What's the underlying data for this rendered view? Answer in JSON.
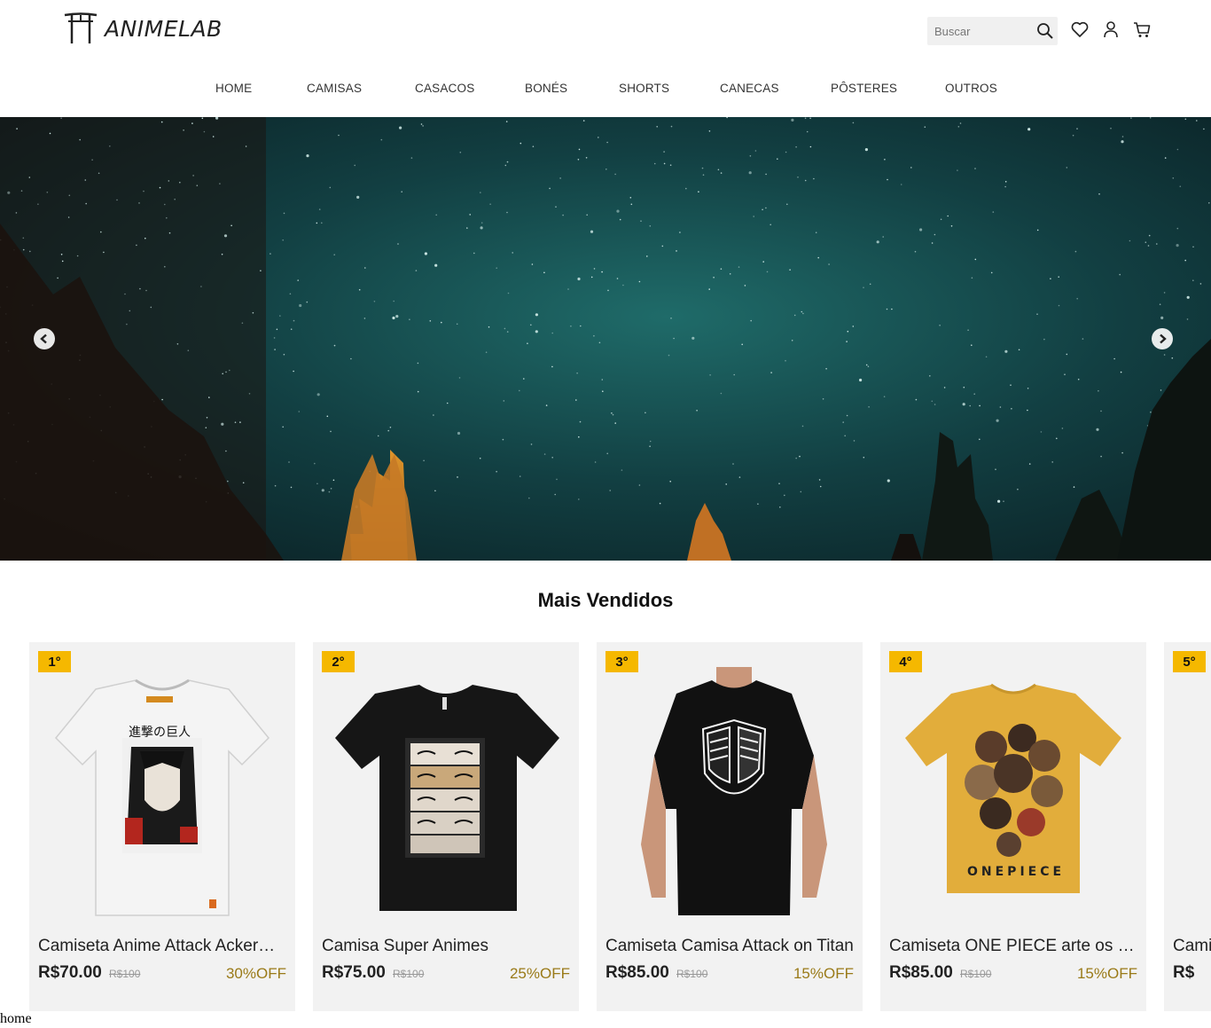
{
  "brand": {
    "name": "ANIMELAB"
  },
  "header": {
    "search_placeholder": "Buscar",
    "icons": [
      "search-icon",
      "heart-icon",
      "user-icon",
      "cart-icon"
    ]
  },
  "nav": {
    "items": [
      {
        "label": "HOME"
      },
      {
        "label": "CAMISAS"
      },
      {
        "label": "CASACOS"
      },
      {
        "label": "BONÉS"
      },
      {
        "label": "SHORTS"
      },
      {
        "label": "CANECAS"
      },
      {
        "label": "PÔSTERES"
      },
      {
        "label": "OUTROS"
      }
    ]
  },
  "hero": {
    "prev_icon": "chevron-left-icon",
    "next_icon": "chevron-right-icon"
  },
  "section": {
    "title": "Mais Vendidos"
  },
  "products": [
    {
      "rank": "1°",
      "name": "Camiseta Anime Attack Ackerman",
      "price": "R$70.00",
      "old_price": "R$100",
      "discount": "30%OFF",
      "shirt_color": "#f4f4f4"
    },
    {
      "rank": "2°",
      "name": "Camisa Super Animes",
      "price": "R$75.00",
      "old_price": "R$100",
      "discount": "25%OFF",
      "shirt_color": "#161616"
    },
    {
      "rank": "3°",
      "name": "Camiseta Camisa Attack on Titan",
      "price": "R$85.00",
      "old_price": "R$100",
      "discount": "15%OFF",
      "shirt_color": "#111111"
    },
    {
      "rank": "4°",
      "name": "Camiseta ONE PIECE arte os Piratas",
      "price": "R$85.00",
      "old_price": "R$100",
      "discount": "15%OFF",
      "shirt_color": "#e2ad3b"
    },
    {
      "rank": "5°",
      "name": "Camiseta",
      "price": "R$",
      "old_price": "",
      "discount": "",
      "shirt_color": "#f2f2f2"
    }
  ],
  "colors": {
    "accent_badge": "#f5b800",
    "discount_text": "#9a7a18",
    "hero_sky": "#0d3b3c"
  },
  "footer": {
    "route_label": "home"
  }
}
